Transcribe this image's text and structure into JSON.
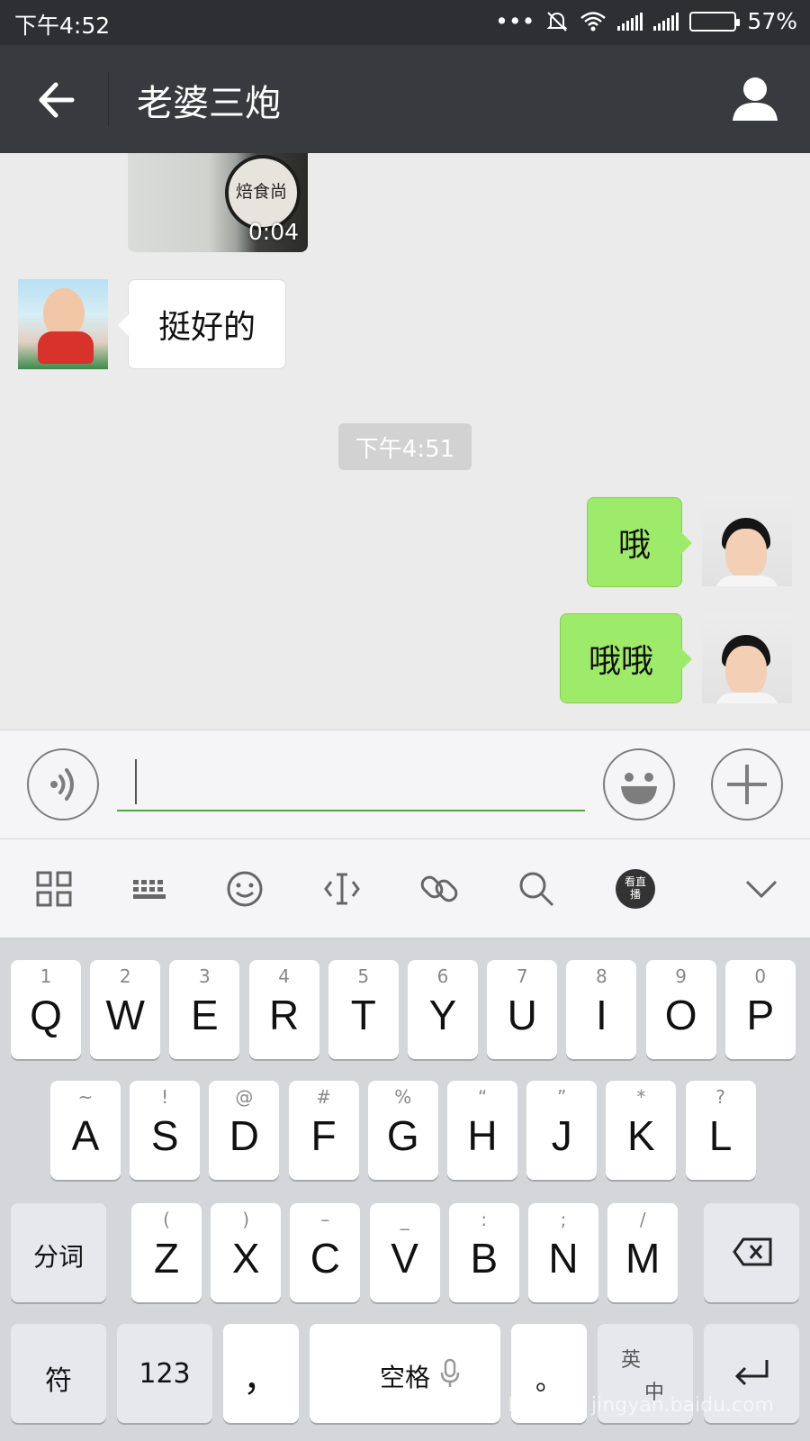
{
  "status_bar": {
    "time": "下午4:52",
    "battery": "57%",
    "battery_level": 0.57
  },
  "header": {
    "back_icon": "arrow-left-icon",
    "title": "老婆三炮",
    "profile_icon": "person-icon"
  },
  "chat": {
    "video": {
      "brand_text": "焙食尚",
      "duration": "0:04"
    },
    "messages": [
      {
        "side": "left",
        "text": "挺好的"
      },
      {
        "side": "right",
        "text": "哦"
      },
      {
        "side": "right",
        "text": "哦哦"
      }
    ],
    "timestamp": "下午4:51"
  },
  "input_bar": {
    "voice_icon": "voice-icon",
    "emoji_icon": "emoji-icon",
    "plus_icon": "plus-icon"
  },
  "ime_toolbar": [
    "grid-icon",
    "keyboard-icon",
    "smiley-icon",
    "cursor-icon",
    "link-icon",
    "search-icon",
    "live-icon",
    "chevron-down-icon"
  ],
  "ime_live_label": "看直播",
  "keyboard": {
    "row1": [
      {
        "sub": "1",
        "main": "Q"
      },
      {
        "sub": "2",
        "main": "W"
      },
      {
        "sub": "3",
        "main": "E"
      },
      {
        "sub": "4",
        "main": "R"
      },
      {
        "sub": "5",
        "main": "T"
      },
      {
        "sub": "6",
        "main": "Y"
      },
      {
        "sub": "7",
        "main": "U"
      },
      {
        "sub": "8",
        "main": "I"
      },
      {
        "sub": "9",
        "main": "O"
      },
      {
        "sub": "0",
        "main": "P"
      }
    ],
    "row2": [
      {
        "sub": "~",
        "main": "A"
      },
      {
        "sub": "!",
        "main": "S"
      },
      {
        "sub": "@",
        "main": "D"
      },
      {
        "sub": "#",
        "main": "F"
      },
      {
        "sub": "%",
        "main": "G"
      },
      {
        "sub": "“",
        "main": "H"
      },
      {
        "sub": "”",
        "main": "J"
      },
      {
        "sub": "*",
        "main": "K"
      },
      {
        "sub": "?",
        "main": "L"
      }
    ],
    "row3": [
      {
        "sub": "(",
        "main": "Z"
      },
      {
        "sub": ")",
        "main": "X"
      },
      {
        "sub": "–",
        "main": "C"
      },
      {
        "sub": "_",
        "main": "V"
      },
      {
        "sub": ":",
        "main": "B"
      },
      {
        "sub": ";",
        "main": "N"
      },
      {
        "sub": "/",
        "main": "M"
      }
    ],
    "fenci": "分词",
    "fu": "符",
    "num": "123",
    "comma": "，",
    "space": "空格",
    "period": "。",
    "lang": "英",
    "lang_sub": "中"
  },
  "watermark": "Bai 经验 jingyan.baidu.com"
}
